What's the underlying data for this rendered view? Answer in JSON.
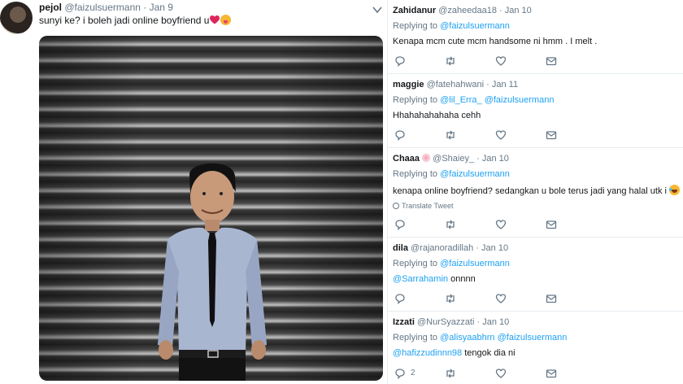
{
  "main_tweet": {
    "name": "pejol",
    "handle": "@faizulsuermann",
    "date": "Jan 9",
    "text": "sunyi ke? i boleh jadi online boyfriend u",
    "emojis": [
      "red-heart",
      "face-with-tongue"
    ]
  },
  "replies": [
    {
      "name": "Zahidanur",
      "handle": "@zaheedaa18",
      "date": "Jan 10",
      "replying_label": "Replying to",
      "replying_to": [
        "@faizulsuermann"
      ],
      "text": "Kenapa mcm cute mcm handsome ni hmm . I melt  .",
      "reply_count": ""
    },
    {
      "name": "maggie",
      "handle": "@fatehahwani",
      "date": "Jan 11",
      "replying_label": "Replying to",
      "replying_to": [
        "@lil_Erra_",
        "@faizulsuermann"
      ],
      "text": "Hhahahahahaha cehh",
      "reply_count": ""
    },
    {
      "name": "Chaaa",
      "handle": "@Shaiey_",
      "date": "Jan 10",
      "replying_label": "Replying to",
      "replying_to": [
        "@faizulsuermann"
      ],
      "text": "kenapa online boyfriend? sedangkan u bole terus jadi yang halal utk i",
      "translate": "Translate Tweet",
      "reply_count": ""
    },
    {
      "name": "dila",
      "handle": "@rajanoradillah",
      "date": "Jan 10",
      "replying_label": "Replying to",
      "replying_to": [
        "@faizulsuermann"
      ],
      "text_mention": "@Sarrahamin",
      "text": "onnnn",
      "reply_count": ""
    },
    {
      "name": "Izzati",
      "handle": "@NurSyazzati",
      "date": "Jan 10",
      "replying_label": "Replying to",
      "replying_to": [
        "@alisyaabhrn",
        "@faizulsuermann"
      ],
      "text_mention": "@hafizzudinnn98",
      "text": "tengok dia ni",
      "reply_count": "2"
    }
  ],
  "icons": {
    "reply": "reply-icon",
    "retweet": "retweet-icon",
    "like": "like-icon",
    "dm": "direct-message-icon",
    "caret": "chevron-down-icon"
  },
  "colors": {
    "link": "#1da1f2",
    "meta": "#657786",
    "text": "#14171a",
    "border": "#e6ecf0"
  }
}
